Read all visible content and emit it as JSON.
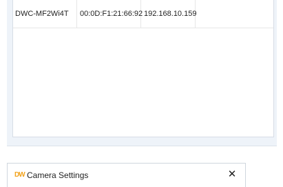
{
  "device_list": {
    "rows": [
      {
        "name": "DWC-MF2Wi4T",
        "mac": "00:0D:F1:21:66:92",
        "ip": "192.168.10.159",
        "extra": ""
      }
    ]
  },
  "camera_settings": {
    "logo_text": "DW",
    "title": "Camera Settings",
    "close_glyph": "✕"
  },
  "colors": {
    "window_background": "#eef3f9",
    "logo": "#f2a31d",
    "text": "#1f1f1f"
  }
}
